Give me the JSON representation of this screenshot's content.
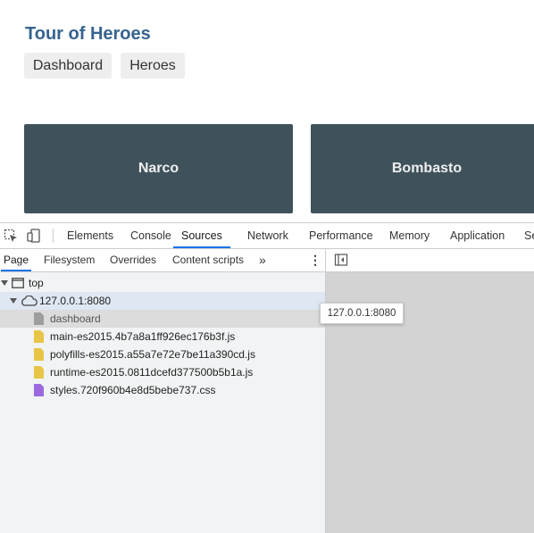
{
  "app": {
    "title": "Tour of Heroes",
    "nav": [
      "Dashboard",
      "Heroes"
    ],
    "heroes": [
      "Narco",
      "Bombasto"
    ]
  },
  "devtools": {
    "tabs": [
      "Elements",
      "Console",
      "Sources",
      "Network",
      "Performance",
      "Memory",
      "Application",
      "Se"
    ],
    "active_tab": "Sources",
    "subtabs": [
      "Page",
      "Filesystem",
      "Overrides",
      "Content scripts"
    ],
    "more_glyph": "»",
    "menu_glyph": "⋮",
    "tree": {
      "top": "top",
      "host": "127.0.0.1:8080",
      "files": [
        {
          "name": "dashboard",
          "type": "document"
        },
        {
          "name": "main-es2015.4b7a8a1ff926ec176b3f.js",
          "type": "script"
        },
        {
          "name": "polyfills-es2015.a55a7e72e7be11a390cd.js",
          "type": "script"
        },
        {
          "name": "runtime-es2015.0811dcefd377500b5b1a.js",
          "type": "script"
        },
        {
          "name": "styles.720f960b4e8d5bebe737.css",
          "type": "stylesheet"
        }
      ]
    },
    "tooltip": "127.0.0.1:8080",
    "colors": {
      "accent": "#1a73e8",
      "script": "#e8c547",
      "stylesheet": "#9c6ade",
      "document": "#9e9e9e"
    }
  }
}
